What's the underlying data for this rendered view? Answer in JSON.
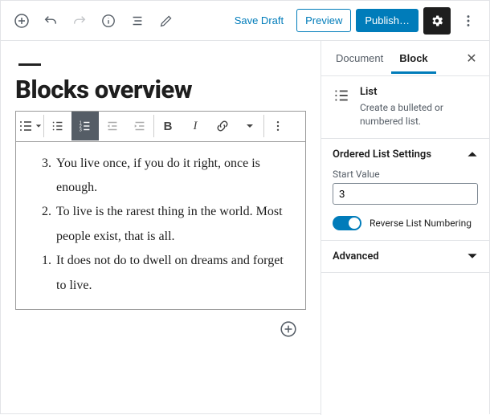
{
  "topbar": {
    "save_draft": "Save Draft",
    "preview": "Preview",
    "publish": "Publish…"
  },
  "editor": {
    "title": "Blocks overview",
    "list_items": [
      {
        "num": "3.",
        "text": "You live once, if you do it right, once is enough."
      },
      {
        "num": "2.",
        "text": "To live is the rarest thing in the world. Most people exist, that is all."
      },
      {
        "num": "1.",
        "text": "It does not do to dwell on dreams and forget to live."
      }
    ]
  },
  "sidebar": {
    "tabs": {
      "document": "Document",
      "block": "Block"
    },
    "block_card": {
      "name": "List",
      "description": "Create a bulleted or numbered list."
    },
    "ordered_panel": {
      "title": "Ordered List Settings",
      "start_label": "Start Value",
      "start_value": "3",
      "reverse_label": "Reverse List Numbering",
      "reverse_on": true
    },
    "advanced_panel": {
      "title": "Advanced"
    }
  }
}
